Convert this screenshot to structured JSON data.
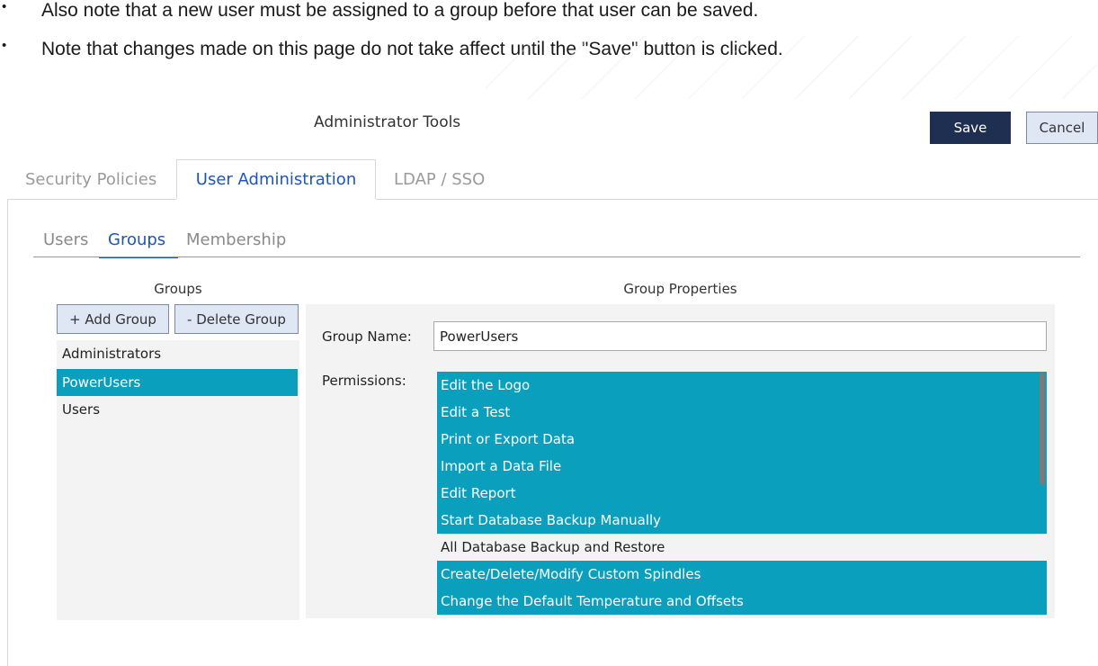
{
  "notes": [
    "Also note that a new user must be assigned to a group before that user can be saved.",
    "Note that changes made on this page do not take affect until the \"Save\" button is clicked."
  ],
  "bullet": "•",
  "window": {
    "title": "Administrator Tools",
    "save_label": "Save",
    "cancel_label": "Cancel"
  },
  "tabs": [
    "Security Policies",
    "User Administration",
    "LDAP / SSO"
  ],
  "subtabs": [
    "Users",
    "Groups",
    "Membership"
  ],
  "groups_panel": {
    "label": "Groups",
    "add_label": "+ Add Group",
    "delete_label": "- Delete Group",
    "items": [
      "Administrators",
      "PowerUsers",
      "Users"
    ],
    "selected": "PowerUsers"
  },
  "properties": {
    "label": "Group Properties",
    "group_name_label": "Group Name:",
    "group_name_value": "PowerUsers",
    "permissions_label": "Permissions:",
    "permissions": [
      {
        "label": "Edit the Logo",
        "selected": true
      },
      {
        "label": "Edit a Test",
        "selected": true
      },
      {
        "label": "Print or Export Data",
        "selected": true
      },
      {
        "label": "Import a Data File",
        "selected": true
      },
      {
        "label": "Edit Report",
        "selected": true
      },
      {
        "label": "Start Database Backup Manually",
        "selected": true
      },
      {
        "label": "All Database Backup and Restore",
        "selected": false
      },
      {
        "label": "Create/Delete/Modify Custom Spindles",
        "selected": true
      },
      {
        "label": "Change the Default Temperature and Offsets",
        "selected": true
      }
    ]
  },
  "colors": {
    "accent": "#0b9fbe",
    "active_tab": "#1e55b8",
    "save_button": "#1f2f52"
  }
}
